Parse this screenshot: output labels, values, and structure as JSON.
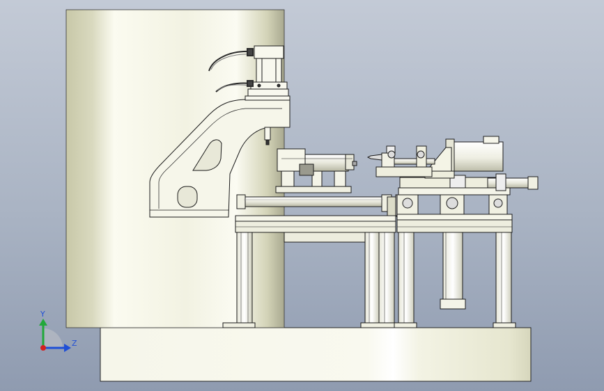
{
  "viewport": {
    "background_top": "#c3cad6",
    "background_bottom": "#8f9bb0",
    "model_color_light": "#fbfbf0",
    "model_color_shadow": "#c9c9b0",
    "edge_color": "#1a1a1a"
  },
  "triad": {
    "y_label": "Y",
    "z_label": "Z",
    "y_color": "#22a83a",
    "z_color": "#1f4fd6",
    "x_color": "#d42020"
  }
}
